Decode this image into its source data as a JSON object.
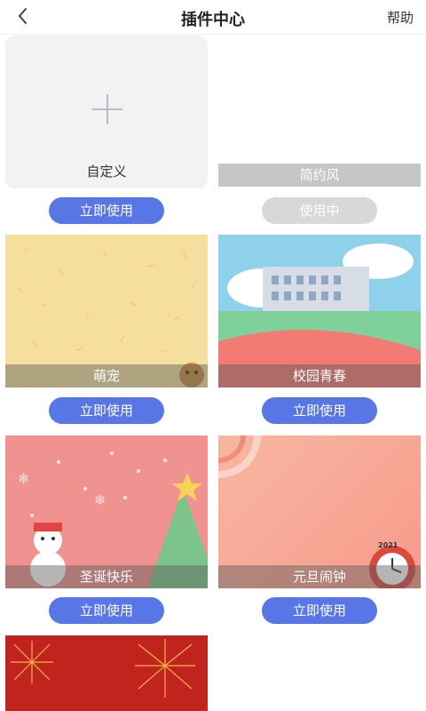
{
  "header": {
    "title": "插件中心",
    "help": "帮助"
  },
  "cards": [
    {
      "label": "自定义",
      "button": "立即使用"
    },
    {
      "label": "简约风",
      "button": "使用中"
    },
    {
      "label": "萌宠",
      "button": "立即使用"
    },
    {
      "label": "校园青春",
      "button": "立即使用"
    },
    {
      "label": "圣诞快乐",
      "button": "立即使用"
    },
    {
      "label": "元旦闹钟",
      "button": "立即使用",
      "badge": "2021"
    }
  ],
  "colors": {
    "primary_button": "#5876e6",
    "disabled_button": "#d8d8d8"
  }
}
